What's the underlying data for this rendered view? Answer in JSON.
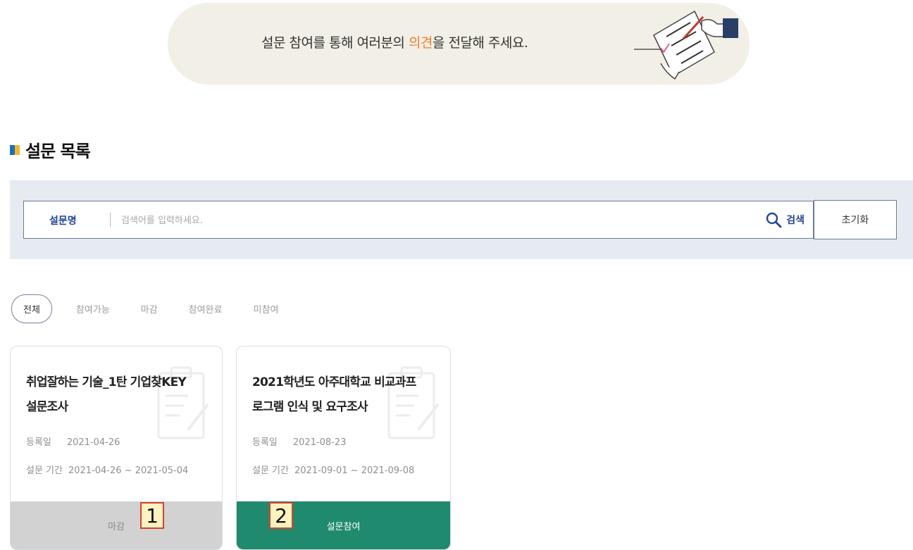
{
  "banner": {
    "text_before": "설문 참여를 통해 여러분의 ",
    "text_highlight": "의견",
    "text_after": "을 전달해 주세요.",
    "highlight_color": "#ef7f2d",
    "illustration_icon": "survey-writing-illustration"
  },
  "section": {
    "title": "설문 목록",
    "icon": "section-square-icon"
  },
  "search": {
    "type_label": "설문명",
    "placeholder": "검색어를 입력하세요.",
    "value": "",
    "search_label": "검색",
    "search_icon": "search-icon",
    "reset_label": "초기화"
  },
  "filters": [
    {
      "label": "전체",
      "active": true
    },
    {
      "label": "참여가능",
      "active": false
    },
    {
      "label": "마감",
      "active": false
    },
    {
      "label": "참여완료",
      "active": false
    },
    {
      "label": "미참여",
      "active": false
    }
  ],
  "cards": [
    {
      "title_line1": "취업잘하는 기술_1탄 기업찾KEY",
      "title_line2": "설문조사",
      "reg_label": "등록일",
      "reg_date": "2021-04-26",
      "period_label": "설문 기간",
      "period": "2021-04-26 ~ 2021-05-04",
      "button_label": "마감",
      "status": "closed"
    },
    {
      "title_line1": "2021학년도 아주대학교 비교과프",
      "title_line2": "로그램 인식 및 요구조사",
      "reg_label": "등록일",
      "reg_date": "2021-08-23",
      "period_label": "설문 기간",
      "period": "2021-09-01 ~ 2021-09-08",
      "button_label": "설문참여",
      "status": "open"
    }
  ],
  "markers": [
    "1",
    "2"
  ],
  "colors": {
    "accent_blue": "#24459a",
    "participate_green": "#1f8a6d",
    "closed_gray": "#d2d2d2",
    "banner_bg": "#f2efe6",
    "search_area_bg": "#e6ebf1"
  }
}
